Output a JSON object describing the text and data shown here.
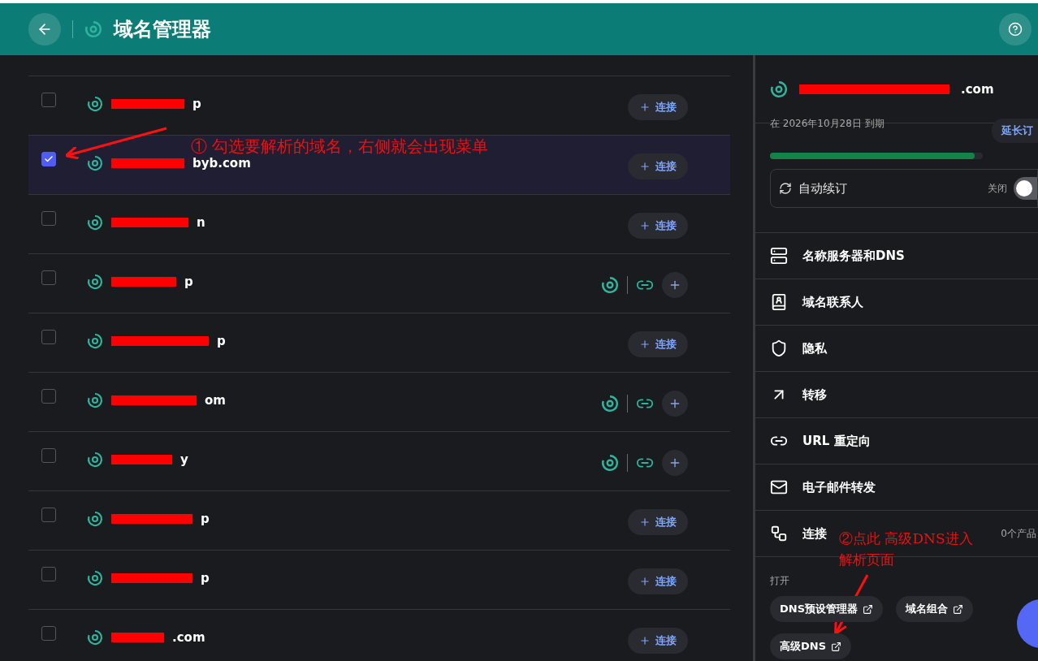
{
  "header": {
    "title": "域名管理器"
  },
  "domains": [
    {
      "name_visible": "p",
      "checked": false,
      "kind": "connect",
      "action": "连接"
    },
    {
      "name_visible": "byb.com",
      "checked": true,
      "kind": "connect",
      "action": "连接"
    },
    {
      "name_visible": "n",
      "checked": false,
      "kind": "connect",
      "action": "连接"
    },
    {
      "name_visible": "p",
      "checked": false,
      "kind": "linked"
    },
    {
      "name_visible": "p",
      "checked": false,
      "kind": "connect",
      "action": "连接"
    },
    {
      "name_visible": "om",
      "checked": false,
      "kind": "linked"
    },
    {
      "name_visible": "y",
      "checked": false,
      "kind": "linked"
    },
    {
      "name_visible": "p",
      "checked": false,
      "kind": "connect",
      "action": "连接"
    },
    {
      "name_visible": "p",
      "checked": false,
      "kind": "connect",
      "action": "连接"
    },
    {
      "name_visible": ".com",
      "checked": false,
      "kind": "connect",
      "action": "连接"
    }
  ],
  "detail": {
    "domain_visible": ".com",
    "expiry": "在 2026年10月28日 到期",
    "extend": "延长订",
    "level": 0.96,
    "auto_renew": {
      "label": "自动续订",
      "state": "关闭",
      "on": false
    },
    "menu": [
      {
        "kind": "dns",
        "label": "名称服务器和DNS"
      },
      {
        "kind": "contact",
        "label": "域名联系人"
      },
      {
        "kind": "privacy",
        "label": "隐私"
      },
      {
        "kind": "transfer",
        "label": "转移"
      },
      {
        "kind": "redirect",
        "label": "URL 重定向"
      },
      {
        "kind": "email",
        "label": "电子邮件转发"
      },
      {
        "kind": "connect",
        "label": "连接",
        "count": "0个产品"
      }
    ],
    "open_label": "打开",
    "links": [
      "DNS预设管理器",
      "域名组合",
      "高级DNS"
    ]
  },
  "annotations": [
    "① 勾选要解析的域名，右侧就会出现菜单",
    "②点此 高级DNS进入解析页面"
  ]
}
